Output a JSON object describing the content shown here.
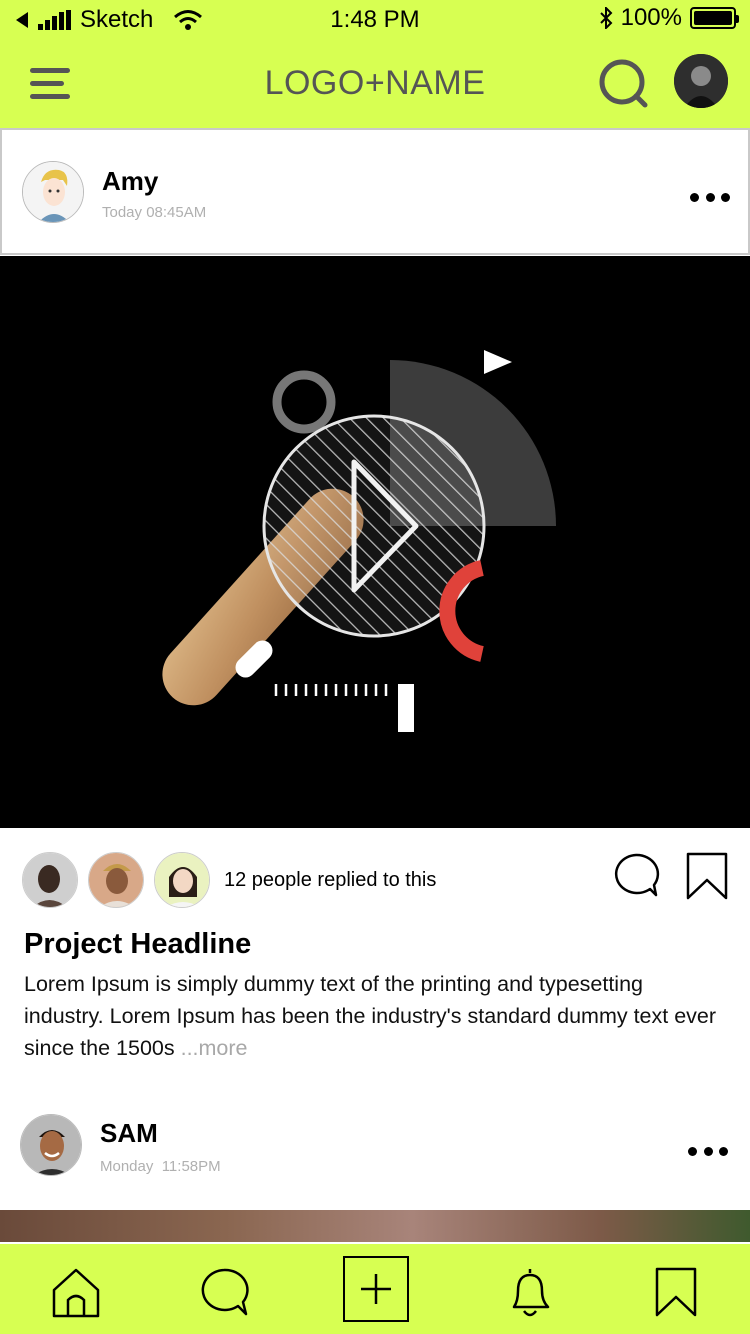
{
  "status_bar": {
    "carrier": "Sketch",
    "time": "1:48 PM",
    "battery_percent": "100%",
    "battery_level": 1.0
  },
  "nav": {
    "title": "LOGO+NAME",
    "icons": [
      "menu-icon",
      "search-icon",
      "avatar"
    ]
  },
  "post": {
    "author": "Amy",
    "time": "Today 08:45AM",
    "media": {
      "icon": "play-icon"
    },
    "replies_text": "12 people replied to this",
    "headline": "Project Headline",
    "body": "Lorem Ipsum is simply dummy text of the printing and typesetting industry. Lorem Ipsum has been the industry's standard dummy text ever since the 1500s ",
    "more_label": "...more"
  },
  "post2": {
    "author": "SAM",
    "time": "Monday  11:58PM"
  },
  "tab_bar": {
    "items": [
      "home-icon",
      "chat-icon",
      "add-icon",
      "bell-icon",
      "bookmark-icon"
    ]
  },
  "colors": {
    "accent": "#d7ff52",
    "media_bg": "#000000",
    "muted_text": "#b0b0b0"
  }
}
